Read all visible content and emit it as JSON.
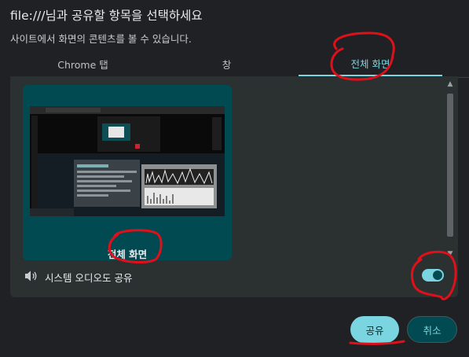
{
  "dialog": {
    "title": "file:///님과 공유할 항목을 선택하세요",
    "subtitle": "사이트에서 화면의 콘텐츠를 볼 수 있습니다."
  },
  "tabs": [
    {
      "label": "Chrome 탭",
      "active": false
    },
    {
      "label": "창",
      "active": false
    },
    {
      "label": "전체 화면",
      "active": true
    }
  ],
  "sources": [
    {
      "label": "전체 화면",
      "selected": true
    }
  ],
  "audio": {
    "label": "시스템 오디오도 공유",
    "enabled": true,
    "icon": "speaker-icon"
  },
  "buttons": {
    "share": "공유",
    "cancel": "취소"
  },
  "colors": {
    "accent": "#7ad5e0",
    "selected_card": "#024a51",
    "annotation": "#e0101a"
  }
}
